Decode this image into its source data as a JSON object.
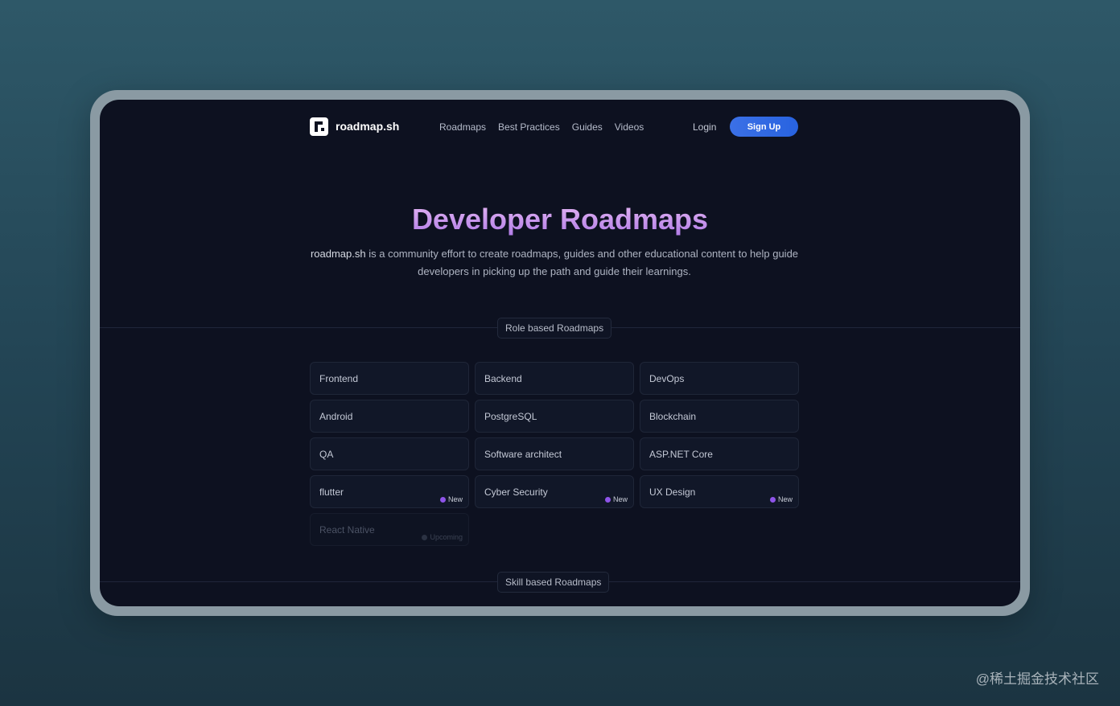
{
  "nav": {
    "brand": "roadmap.sh",
    "links": [
      "Roadmaps",
      "Best Practices",
      "Guides",
      "Videos"
    ],
    "login": "Login",
    "signup": "Sign Up"
  },
  "hero": {
    "title": "Developer Roadmaps",
    "desc_strong": "roadmap.sh",
    "desc_rest": " is a community effort to create roadmaps, guides and other educational content to help guide developers in picking up the path and guide their learnings."
  },
  "sections": {
    "role": "Role based Roadmaps",
    "skill": "Skill based Roadmaps"
  },
  "roadmaps": [
    {
      "label": "Frontend",
      "badge": ""
    },
    {
      "label": "Backend",
      "badge": ""
    },
    {
      "label": "DevOps",
      "badge": ""
    },
    {
      "label": "Android",
      "badge": ""
    },
    {
      "label": "PostgreSQL",
      "badge": ""
    },
    {
      "label": "Blockchain",
      "badge": ""
    },
    {
      "label": "QA",
      "badge": ""
    },
    {
      "label": "Software architect",
      "badge": ""
    },
    {
      "label": "ASP.NET Core",
      "badge": ""
    },
    {
      "label": "flutter",
      "badge": "New"
    },
    {
      "label": "Cyber Security",
      "badge": "New"
    },
    {
      "label": "UX Design",
      "badge": "New"
    },
    {
      "label": "React Native",
      "badge": "Upcoming"
    }
  ],
  "watermark": "@稀土掘金技术社区",
  "colors": {
    "accent": "#2863e0",
    "title_gradient_start": "#e4b6f3",
    "title_gradient_end": "#b07be6",
    "badge_dot": "#8e54e9"
  }
}
